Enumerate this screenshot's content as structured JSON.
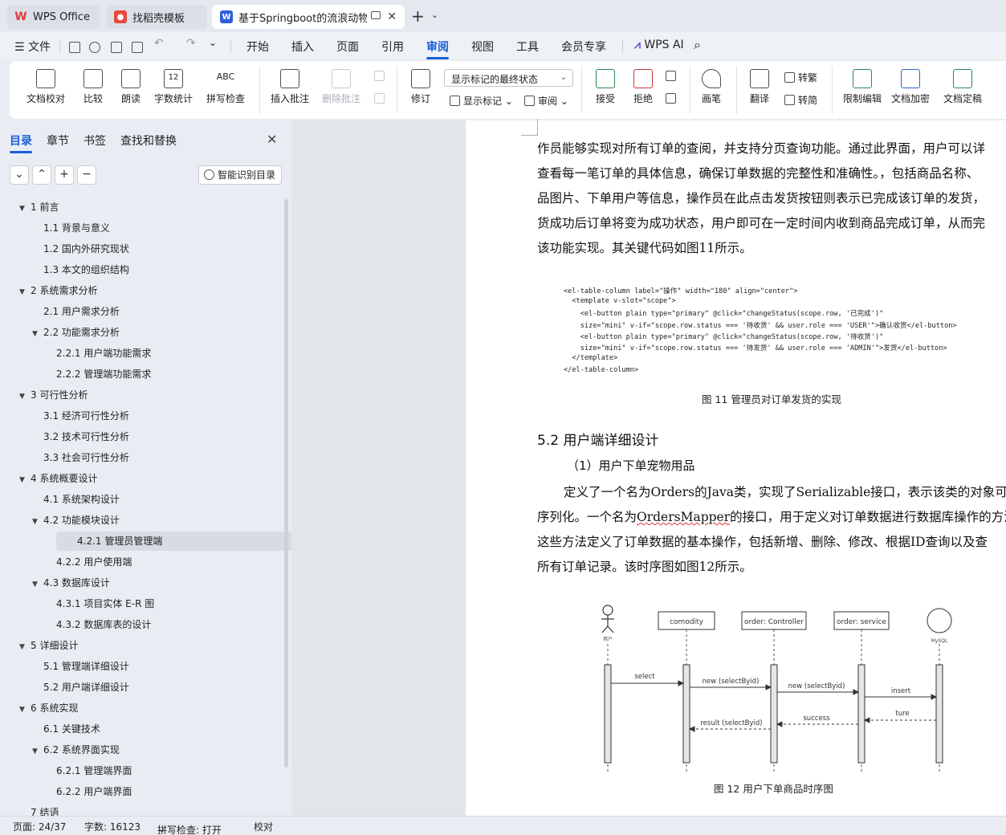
{
  "tabs": [
    {
      "label": "WPS Office",
      "icon": "wps-logo-icon",
      "color": "#e23b3b"
    },
    {
      "label": "找稻壳模板",
      "icon": "docer-icon",
      "color": "#e8483d"
    },
    {
      "label": "基于Springboot的流浪动物管",
      "icon": "writer-doc-icon",
      "color": "#2b5fd9"
    }
  ],
  "menu": {
    "file": "文件",
    "items": [
      "开始",
      "插入",
      "页面",
      "引用",
      "审阅",
      "视图",
      "工具",
      "会员专享"
    ],
    "active": "审阅",
    "ai": "WPS AI"
  },
  "ribbon": {
    "buttons": [
      "文档校对",
      "比较",
      "朗读",
      "字数统计",
      "拼写检查",
      "插入批注",
      "删除批注",
      "修订",
      "接受",
      "拒绝",
      "画笔",
      "翻译",
      "限制编辑",
      "文档加密",
      "文档定稿"
    ],
    "markup_state": "显示标记的最终状态",
    "show_markup": "显示标记",
    "review": "审阅",
    "to_traditional": "转繁",
    "to_simplified": "转简",
    "abc": "ABC",
    "num": "12"
  },
  "panel": {
    "tabs": [
      "目录",
      "章节",
      "书签",
      "查找和替换"
    ],
    "smart_button": "智能识别目录",
    "toc": [
      {
        "level": 1,
        "text": "1 前言",
        "expanded": true
      },
      {
        "level": 2,
        "text": "1.1 背景与意义"
      },
      {
        "level": 2,
        "text": "1.2 国内外研究现状"
      },
      {
        "level": 2,
        "text": "1.3 本文的组织结构"
      },
      {
        "level": 1,
        "text": "2 系统需求分析",
        "expanded": true
      },
      {
        "level": 2,
        "text": "2.1 用户需求分析"
      },
      {
        "level": 2,
        "text": "2.2 功能需求分析",
        "expanded": true
      },
      {
        "level": 3,
        "text": "2.2.1 用户端功能需求"
      },
      {
        "level": 3,
        "text": "2.2.2 管理端功能需求"
      },
      {
        "level": 1,
        "text": "3 可行性分析",
        "expanded": true
      },
      {
        "level": 2,
        "text": "3.1 经济可行性分析"
      },
      {
        "level": 2,
        "text": "3.2 技术可行性分析"
      },
      {
        "level": 2,
        "text": "3.3 社会可行性分析"
      },
      {
        "level": 1,
        "text": "4 系统概要设计",
        "expanded": true
      },
      {
        "level": 2,
        "text": "4.1 系统架构设计"
      },
      {
        "level": 2,
        "text": "4.2 功能模块设计",
        "expanded": true
      },
      {
        "level": 3,
        "text": "4.2.1 管理员管理端",
        "selected": true
      },
      {
        "level": 3,
        "text": "4.2.2 用户使用端"
      },
      {
        "level": 2,
        "text": "4.3 数据库设计",
        "expanded": true
      },
      {
        "level": 3,
        "text": "4.3.1 项目实体 E-R 图"
      },
      {
        "level": 3,
        "text": "4.3.2 数据库表的设计"
      },
      {
        "level": 1,
        "text": "5 详细设计",
        "expanded": true
      },
      {
        "level": 2,
        "text": "5.1 管理端详细设计"
      },
      {
        "level": 2,
        "text": "5.2 用户端详细设计"
      },
      {
        "level": 1,
        "text": "6  系统实现",
        "expanded": true
      },
      {
        "level": 2,
        "text": "6.1 关键技术"
      },
      {
        "level": 2,
        "text": "6.2 系统界面实现",
        "expanded": true
      },
      {
        "level": 3,
        "text": "6.2.1 管理端界面"
      },
      {
        "level": 3,
        "text": "6.2.2 用户端界面"
      },
      {
        "level": 1,
        "text": "7 结语"
      }
    ]
  },
  "doc": {
    "para1": [
      "作员能够实现对所有订单的查阅，并支持分页查询功能。通过此界面，用户可以详",
      "查看每一笔订单的具体信息，确保订单数据的完整性和准确性。，包括商品名称、",
      "品图片、下单用户等信息，操作员在此点击发货按钮则表示已完成该订单的发货，",
      "货成功后订单将变为成功状态，用户即可在一定时间内收到商品完成订单，从而完",
      "该功能实现。其关键代码如图11所示。"
    ],
    "code": [
      "<el-table-column label=\"操作\" width=\"180\" align=\"center\">",
      "  <template v-slot=\"scope\">",
      "    <el-button plain type=\"primary\" @click=\"changeStatus(scope.row, '已完成')\"",
      "    size=\"mini\" v-if=\"scope.row.status === '待收货' && user.role === 'USER'\">确认收货</el-button>",
      "    <el-button plain type=\"primary\" @click=\"changeStatus(scope.row, '待收货')\"",
      "    size=\"mini\" v-if=\"scope.row.status === '待发货' && user.role === 'ADMIN'\">发货</el-button>",
      "  </template>",
      "</el-table-column>"
    ],
    "fig11_caption": "图 11  管理员对订单发货的实现",
    "heading": "5.2 用户端详细设计",
    "subhead": "（1）用户下单宠物用品",
    "para2_line1": "定义了一个名为Orders的Java类，实现了Serializable接口，表示该类的对象可以",
    "para2_line2_pre": "序列化。一个名为",
    "para2_line2_mapper": "OrdersMapper",
    "para2_line2_post": "的接口，用于定义对订单数据进行数据库操作的方法",
    "para2_line3": "这些方法定义了订单数据的基本操作，包括新增、删除、修改、根据ID查询以及查",
    "para2_line4": "所有订单记录。该时序图如图12所示。",
    "fig12_caption": "图 12  用户下单商品时序图",
    "sequence": {
      "actor": "用户",
      "participants": [
        "comodity",
        "order: Controller",
        "order: service",
        "MySQL"
      ],
      "messages": [
        "select",
        "new  (selectByid)",
        "new  (selectByid)",
        "insert",
        "ture",
        "success",
        "result  (selectByid)"
      ]
    }
  },
  "status": {
    "page": "页面: 24/37",
    "words": "字数: 16123",
    "spell": "拼写检查: 打开",
    "proof": "校对"
  }
}
